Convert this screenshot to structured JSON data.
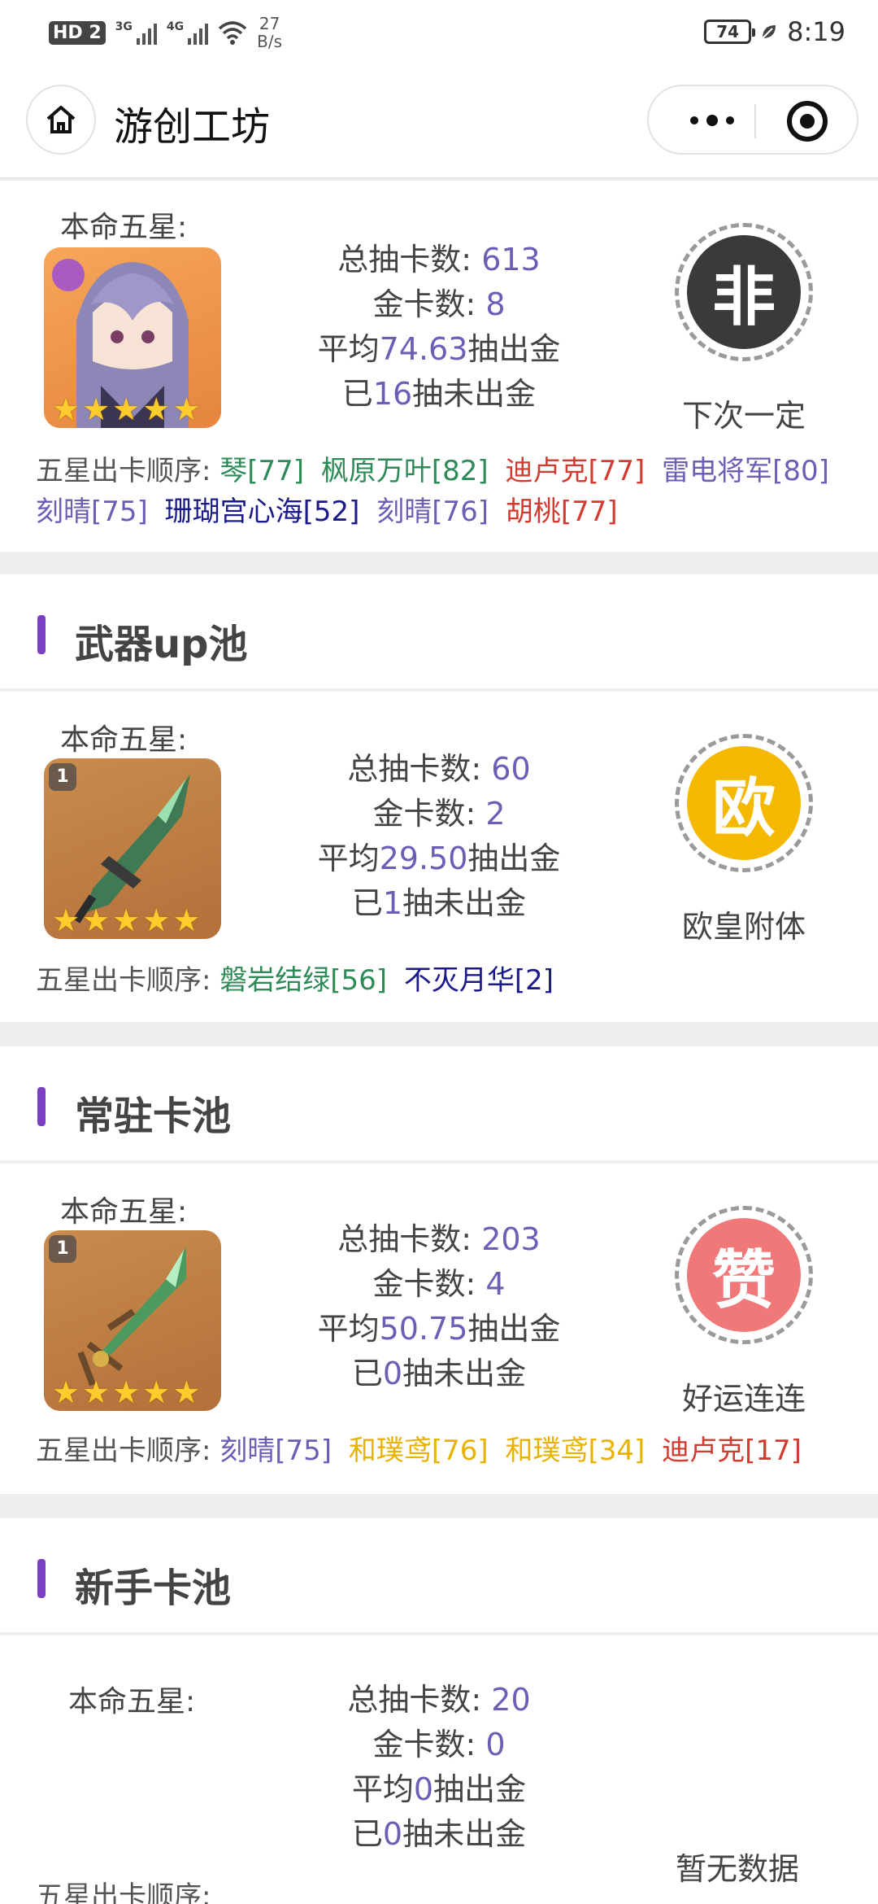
{
  "status": {
    "hd": "HD",
    "hd_num": "2",
    "sig1": "3G",
    "sig2": "4G",
    "speed_top": "27",
    "speed_bottom": "B/s",
    "battery": "74",
    "time": "8:19"
  },
  "nav": {
    "title": "游创工坊"
  },
  "pools": [
    {
      "star_label": "本命五星:",
      "total_label": "总抽卡数:",
      "total": "613",
      "gold_label": "金卡数:",
      "gold": "8",
      "avg_prefix": "平均",
      "avg": "74.63",
      "avg_suffix": "抽出金",
      "since_prefix": "已",
      "since": "16",
      "since_suffix": "抽未出金",
      "badge_char": "非",
      "badge_color": "#3a3a3a",
      "badge_caption": "下次一定",
      "order_label": "五星出卡顺序:",
      "order": [
        {
          "text": "琴[77]",
          "color": "green"
        },
        {
          "text": "枫原万叶[82]",
          "color": "green"
        },
        {
          "text": "迪卢克[77]",
          "color": "red"
        },
        {
          "text": "雷电将军[80]",
          "color": "purple"
        },
        {
          "text": "刻晴[75]",
          "color": "purple"
        },
        {
          "text": "珊瑚宫心海[52]",
          "color": "navy"
        },
        {
          "text": "刻晴[76]",
          "color": "purple"
        },
        {
          "text": "胡桃[77]",
          "color": "red"
        }
      ]
    },
    {
      "section_title": "武器up池",
      "star_label": "本命五星:",
      "total_label": "总抽卡数:",
      "total": "60",
      "gold_label": "金卡数:",
      "gold": "2",
      "avg_prefix": "平均",
      "avg": "29.50",
      "avg_suffix": "抽出金",
      "since_prefix": "已",
      "since": "1",
      "since_suffix": "抽未出金",
      "badge_char": "欧",
      "badge_color": "#f5b800",
      "badge_caption": "欧皇附体",
      "rank": "1",
      "order_label": "五星出卡顺序:",
      "order": [
        {
          "text": "磐岩结绿[56]",
          "color": "green"
        },
        {
          "text": "不灭月华[2]",
          "color": "navy"
        }
      ]
    },
    {
      "section_title": "常驻卡池",
      "star_label": "本命五星:",
      "total_label": "总抽卡数:",
      "total": "203",
      "gold_label": "金卡数:",
      "gold": "4",
      "avg_prefix": "平均",
      "avg": "50.75",
      "avg_suffix": "抽出金",
      "since_prefix": "已",
      "since": "0",
      "since_suffix": "抽未出金",
      "badge_char": "赞",
      "badge_color": "#f07878",
      "badge_caption": "好运连连",
      "rank": "1",
      "order_label": "五星出卡顺序:",
      "order": [
        {
          "text": "刻晴[75]",
          "color": "purple"
        },
        {
          "text": "和璞鸢[76]",
          "color": "gold"
        },
        {
          "text": "和璞鸢[34]",
          "color": "gold"
        },
        {
          "text": "迪卢克[17]",
          "color": "red"
        }
      ]
    },
    {
      "section_title": "新手卡池",
      "star_label": "本命五星:",
      "total_label": "总抽卡数:",
      "total": "20",
      "gold_label": "金卡数:",
      "gold": "0",
      "avg_prefix": "平均",
      "avg": "0",
      "avg_suffix": "抽出金",
      "since_prefix": "已",
      "since": "0",
      "since_suffix": "抽未出金",
      "badge_caption": "暂无数据",
      "order_label": "五星出卡顺序:"
    }
  ]
}
